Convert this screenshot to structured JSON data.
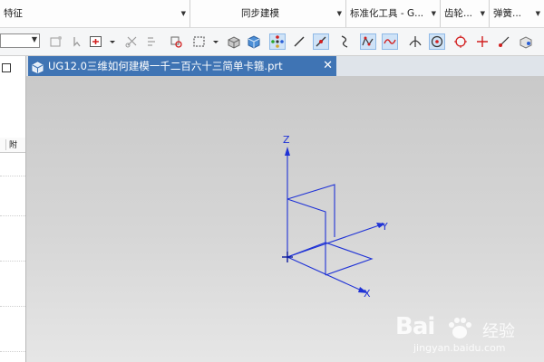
{
  "ribbon": {
    "groups": [
      {
        "label": "特征"
      },
      {
        "label": "同步建模"
      },
      {
        "label": "标准化工具 - G..."
      },
      {
        "label": "齿轮..."
      },
      {
        "label": "弹簧..."
      }
    ]
  },
  "document_tab": {
    "title": "UG12.0三维如何建模一千二百六十三简单卡箍.prt",
    "close_glyph": "✕"
  },
  "left_panel": {
    "header_text": "附"
  },
  "viewport": {
    "axis_labels": {
      "z": "Z",
      "y": "Y",
      "x": "X"
    },
    "line_color": "#1f32d6"
  },
  "watermark": {
    "brand": "Bai",
    "brand_suffix": "经验",
    "url": "jingyan.baidu.com"
  },
  "icons": [
    "document-icon",
    "snap-point-icon",
    "line-icon",
    "arc-icon",
    "spline-icon",
    "circle-icon",
    "crosshair-icon",
    "cube-icon",
    "rectangle-select-icon"
  ]
}
